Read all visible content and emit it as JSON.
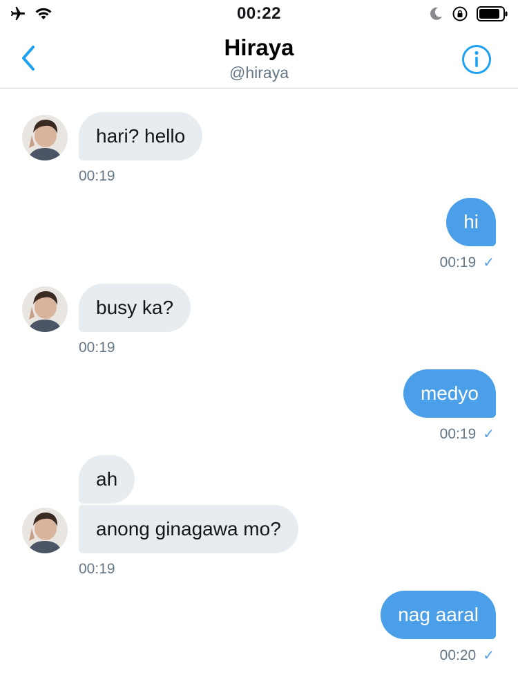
{
  "status_bar": {
    "time": "00:22",
    "icons": [
      "airplane-icon",
      "wifi-icon",
      "moon-icon",
      "orientation-lock-icon",
      "battery-icon"
    ]
  },
  "header": {
    "name": "Hiraya",
    "handle": "@hiraya",
    "back_icon": "chevron-left-icon",
    "info_icon": "info-icon",
    "accent": "#1da1f2"
  },
  "messages": [
    {
      "direction": "in",
      "text": "hari? hello",
      "time": "00:19"
    },
    {
      "direction": "out",
      "text": "hi",
      "time": "00:19",
      "status": "✓"
    },
    {
      "direction": "in",
      "text": "busy ka?",
      "time": "00:19"
    },
    {
      "direction": "out",
      "text": "medyo",
      "time": "00:19",
      "status": "✓"
    },
    {
      "direction": "in",
      "text": "ah"
    },
    {
      "direction": "in",
      "text": "anong ginagawa mo?",
      "time": "00:19"
    },
    {
      "direction": "out",
      "text": "nag aaral",
      "time": "00:20",
      "status": "✓"
    }
  ],
  "colors": {
    "incoming_bubble": "#e6ecf0",
    "outgoing_bubble": "#4a9fe8",
    "timestamp": "#657786"
  }
}
